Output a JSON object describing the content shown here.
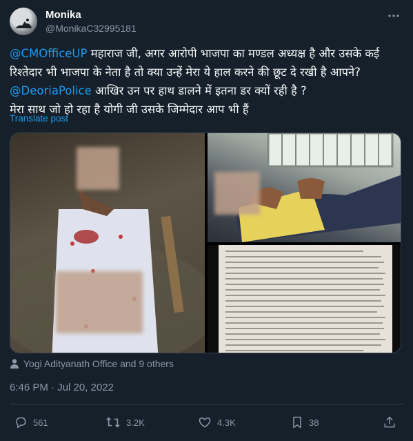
{
  "author": {
    "name": "Monika",
    "handle": "@MonikaC32995181"
  },
  "tweet": {
    "mention1": "@CMOfficeUP",
    "line1_rest": " महाराज जी, अगर आरोपी भाजपा का मण्डल अध्यक्ष है और उसके कई रिश्तेदार भी भाजपा के नेता है तो क्या उन्हें मेरा ये हाल करने की छूट दे रखी है आपने?",
    "mention2": "@DeoriaPolice",
    "line2_rest": " आखिर उन पर हाथ डालने में इतना डर क्यों रही है ?",
    "line3": "मेरा साथ जो हो रहा है योगी जी उसके जिम्मेदार आप भी हैं",
    "translate_label": "Translate post"
  },
  "tagged": {
    "text": "Yogi Adityanath Office and 9 others"
  },
  "timestamp": "6:46 PM · Jul 20, 2022",
  "actions": {
    "replies": "561",
    "reposts": "3.2K",
    "likes": "4.3K",
    "bookmarks": "38"
  },
  "colors": {
    "background": "#15202b",
    "link": "#1d9bf0",
    "muted": "#8b98a5",
    "border": "#38444d"
  }
}
